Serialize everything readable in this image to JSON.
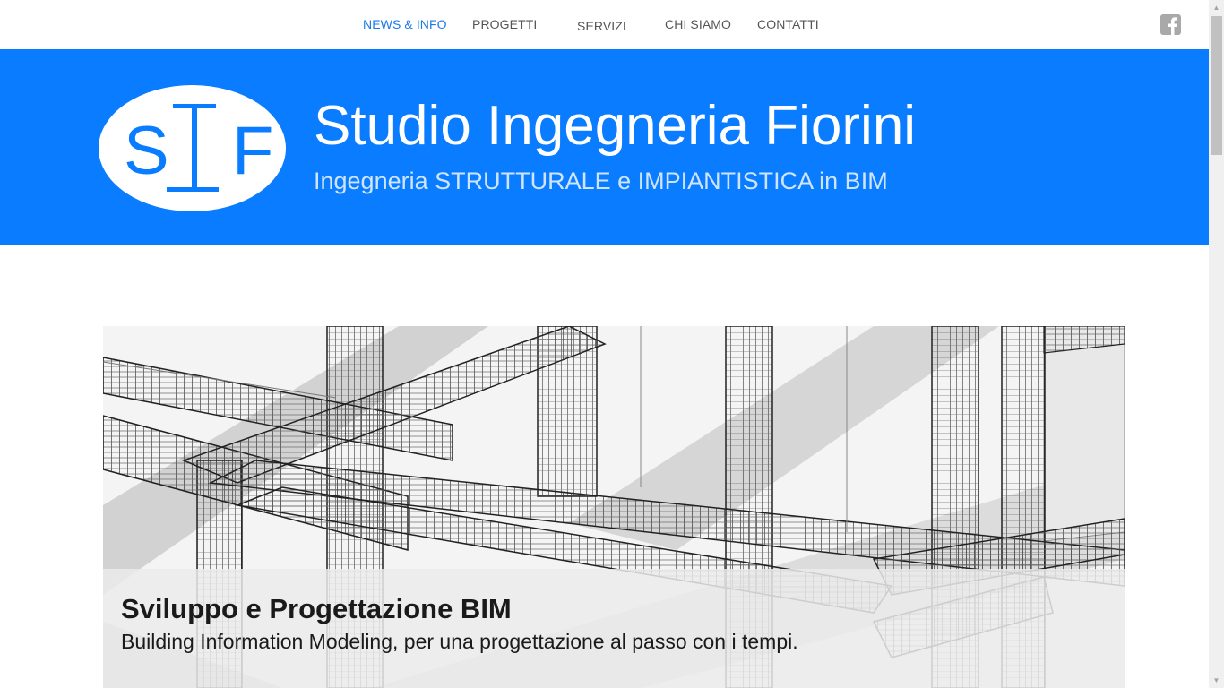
{
  "nav": {
    "items": [
      {
        "label": "NEWS & INFO",
        "active": true
      },
      {
        "label": "PROGETTI",
        "active": false
      },
      {
        "label": "SERVIZI",
        "active": false
      },
      {
        "label": "CHI SIAMO",
        "active": false
      },
      {
        "label": "CONTATTI",
        "active": false
      }
    ],
    "social_icon": "facebook-icon"
  },
  "header": {
    "logo_letters": "SIF",
    "title": "Studio Ingegneria Fiorini",
    "subtitle": "Ingegneria STRUTTURALE e IMPIANTISTICA in BIM"
  },
  "banner": {
    "title": "Sviluppo e Progettazione BIM",
    "text": "Building Information Modeling, per una progettazione al passo con i tempi."
  },
  "colors": {
    "accent": "#0a7cff",
    "nav_active": "#1a7ae6",
    "nav_text": "#555555"
  }
}
